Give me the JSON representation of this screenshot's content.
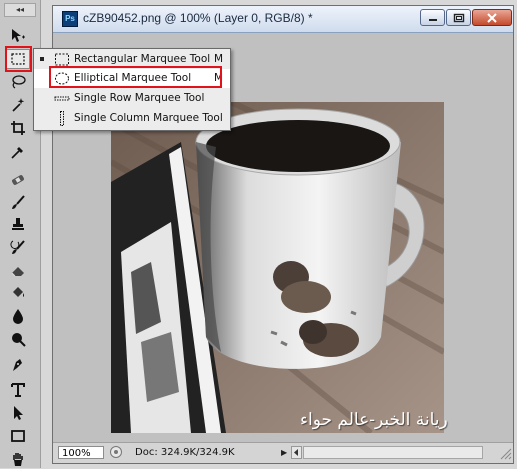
{
  "document": {
    "title": "cZB90452.png @ 100% (Layer 0, RGB/8) *",
    "app_icon_label": "Ps",
    "zoom": "100%",
    "doc_info": "Doc: 324.9K/324.9K"
  },
  "flyout": {
    "items": [
      {
        "label": "Rectangular Marquee Tool",
        "shortcut": "M",
        "icon": "rect-marquee-icon",
        "current": true
      },
      {
        "label": "Elliptical Marquee Tool",
        "shortcut": "M",
        "icon": "ellipse-marquee-icon",
        "highlighted": true
      },
      {
        "label": "Single Row Marquee Tool",
        "shortcut": "",
        "icon": "single-row-marquee-icon"
      },
      {
        "label": "Single Column Marquee Tool",
        "shortcut": "",
        "icon": "single-column-marquee-icon"
      }
    ]
  },
  "toolbar": {
    "tools": [
      "move-tool-icon",
      "rect-marquee-tool-icon",
      "lasso-tool-icon",
      "magic-wand-tool-icon",
      "crop-tool-icon",
      "eyedropper-tool-icon",
      "healing-brush-tool-icon",
      "brush-tool-icon",
      "clone-stamp-tool-icon",
      "history-brush-tool-icon",
      "eraser-tool-icon",
      "paint-bucket-tool-icon",
      "blur-tool-icon",
      "dodge-tool-icon",
      "pen-tool-icon",
      "type-tool-icon",
      "path-selection-tool-icon",
      "rectangle-shape-tool-icon",
      "hand-tool-icon"
    ]
  },
  "watermark": "ريانة الخبر-عالم حواء",
  "colors": {
    "highlight": "#e0131b",
    "titlebar": "#cfdced"
  }
}
